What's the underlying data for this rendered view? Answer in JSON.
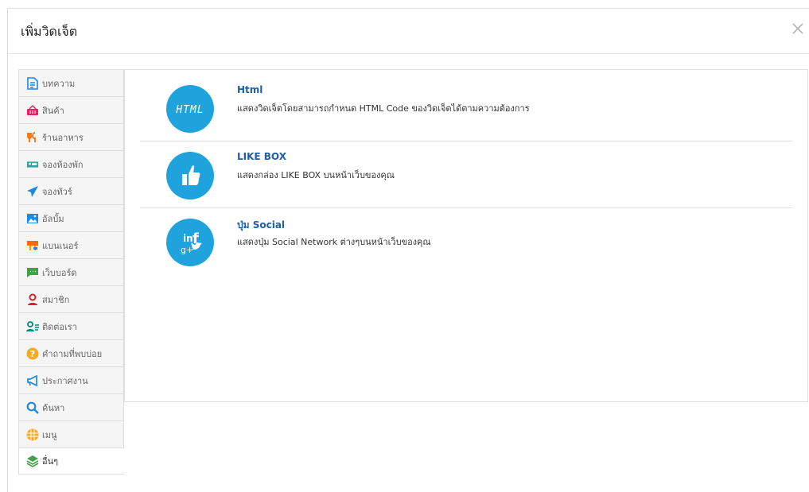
{
  "modal": {
    "title": "เพิ่มวิดเจ็ต",
    "close_icon": "close-icon"
  },
  "sidebar": {
    "items": [
      {
        "label": "บทความ",
        "icon": "article-icon",
        "color": "#1e88e5"
      },
      {
        "label": "สินค้า",
        "icon": "basket-icon",
        "color": "#e91e63"
      },
      {
        "label": "ร้านอาหาร",
        "icon": "restaurant-icon",
        "color": "#ff6d00"
      },
      {
        "label": "จองห้องพัก",
        "icon": "hotel-icon",
        "color": "#26a69a"
      },
      {
        "label": "จองทัวร์",
        "icon": "plane-icon",
        "color": "#1e88e5"
      },
      {
        "label": "อัลบั้ม",
        "icon": "image-icon",
        "color": "#1e88e5"
      },
      {
        "label": "แบนเนอร์",
        "icon": "banner-icon",
        "color": "#ff6d00"
      },
      {
        "label": "เว็บบอร์ด",
        "icon": "chat-icon",
        "color": "#43a047"
      },
      {
        "label": "สมาชิก",
        "icon": "user-icon",
        "color": "#c62828"
      },
      {
        "label": "ติดต่อเรา",
        "icon": "contact-icon",
        "color": "#00897b"
      },
      {
        "label": "คำถามที่พบบ่อย",
        "icon": "question-icon",
        "color": "#f9a825"
      },
      {
        "label": "ประกาศงาน",
        "icon": "megaphone-icon",
        "color": "#1e88e5"
      },
      {
        "label": "ค้นหา",
        "icon": "search-icon",
        "color": "#1e88e5"
      },
      {
        "label": "เมนู",
        "icon": "grid-icon",
        "color": "#f9a825"
      },
      {
        "label": "อื่นๆ",
        "icon": "layers-icon",
        "color": "#43a047",
        "active": true
      }
    ]
  },
  "widgets": [
    {
      "title": "Html",
      "description": "แสดงวิดเจ็ตโดยสามารถกำหนด HTML Code ของวิดเจ็ตได้ตามความต้องการ",
      "icon": "html-icon",
      "icon_text": "HTML"
    },
    {
      "title": "LIKE BOX",
      "description": "แสดงกล่อง LIKE BOX บนหน้าเว็บของคุณ",
      "icon": "thumbs-up-icon"
    },
    {
      "title": "ปุ่ม Social",
      "description": "แสดงปุ่ม Social Network ต่างๆบนหน้าเว็บของคุณ",
      "icon": "social-icon",
      "icon_text_a": "in",
      "icon_text_b": "f",
      "icon_text_c": "g+"
    }
  ],
  "colors": {
    "accent": "#1fa3dc",
    "title_link": "#1d5fa8"
  }
}
